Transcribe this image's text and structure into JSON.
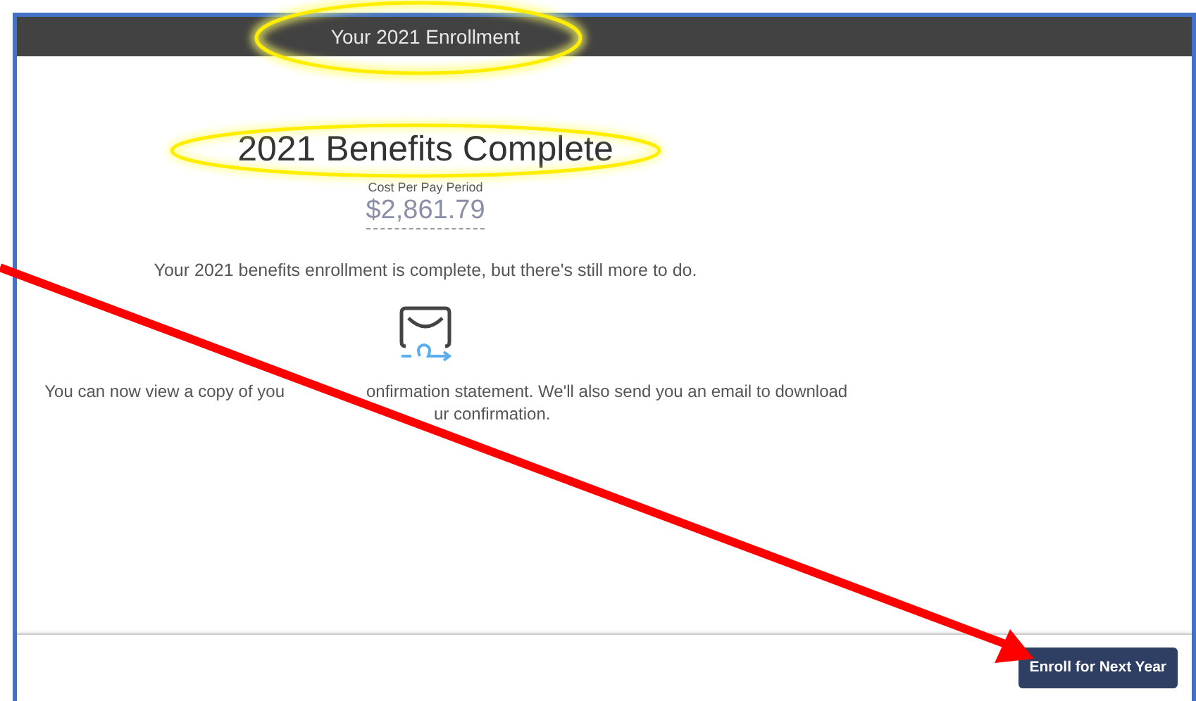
{
  "header": {
    "title": "Your 2021 Enrollment"
  },
  "summary": {
    "heading": "2021 Benefits Complete",
    "cost_label": "Cost Per Pay Period",
    "cost": "$2,861.79",
    "message": "Your 2021 benefits enrollment is complete, but there's still more to do.",
    "note_parts": [
      "You can now view a copy of you",
      "onfirmation statement. We'll also send you an email to download",
      "ur confirmation."
    ]
  },
  "footer": {
    "button": "Enroll for Next Year"
  }
}
